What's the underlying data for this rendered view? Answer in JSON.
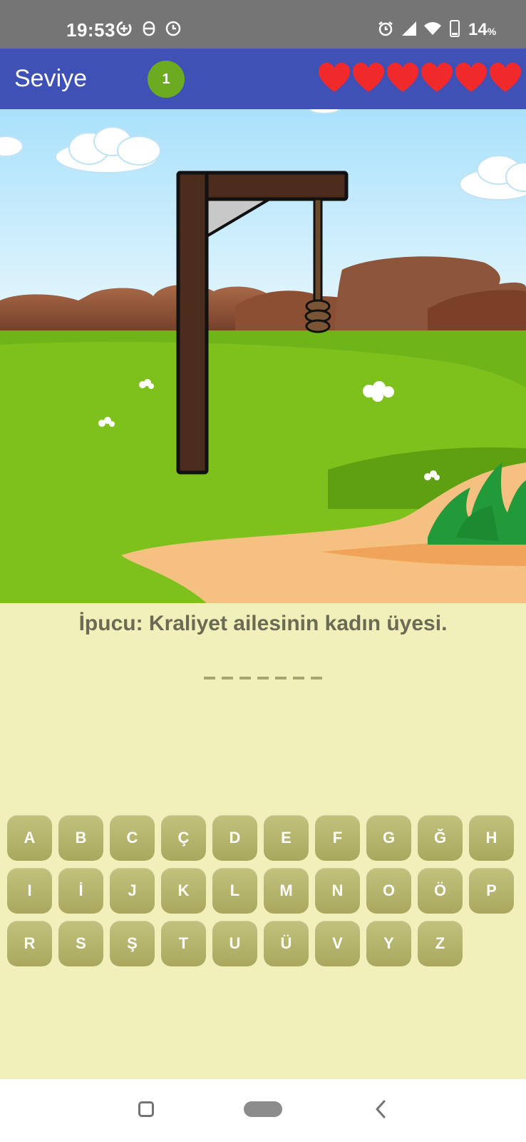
{
  "status_bar": {
    "time": "19:53",
    "battery": "14",
    "battery_unit": "%",
    "icons": [
      "data-saver-icon",
      "privacy-icon",
      "clock-icon",
      "alarm-icon",
      "signal-icon",
      "wifi-icon",
      "battery-icon"
    ]
  },
  "app_bar": {
    "title": "Seviye",
    "level": "1",
    "lives": 6,
    "heart_color": "#f02a2a"
  },
  "game": {
    "hint": "İpucu: Kraliyet ailesinin kadın üyesi.",
    "word_length": 7
  },
  "keyboard": {
    "rows": [
      [
        "A",
        "B",
        "C",
        "Ç",
        "D",
        "E",
        "F",
        "G",
        "Ğ",
        "H"
      ],
      [
        "I",
        "İ",
        "J",
        "K",
        "L",
        "M",
        "N",
        "O",
        "Ö",
        "P"
      ],
      [
        "R",
        "S",
        "Ş",
        "T",
        "U",
        "Ü",
        "V",
        "Y",
        "Z"
      ]
    ]
  },
  "colors": {
    "app_bar": "#3f51b5",
    "status_bar": "#757575",
    "badge": "#6cab1f",
    "panel": "#f1f0bb",
    "key": "#b5b46c"
  }
}
